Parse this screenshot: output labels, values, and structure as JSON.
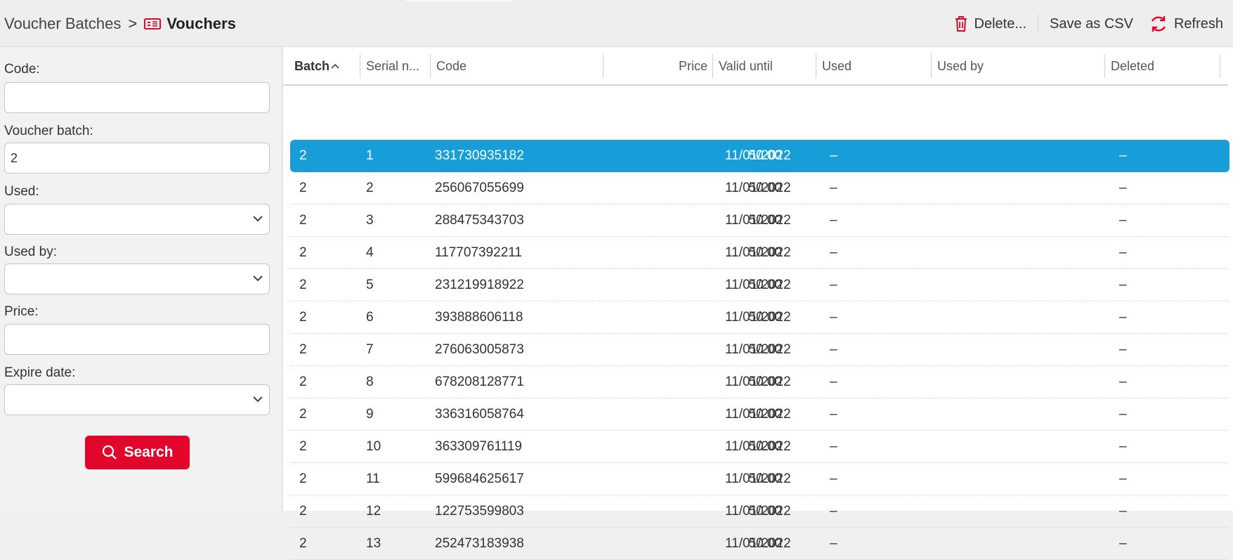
{
  "breadcrumb": {
    "parent": "Voucher Batches",
    "separator": ">",
    "current": "Vouchers",
    "current_icon": "voucher-icon"
  },
  "toolbar": {
    "delete_label": "Delete...",
    "delete_icon": "trash-icon",
    "csv_label": "Save as CSV",
    "refresh_label": "Refresh",
    "refresh_icon": "refresh-icon"
  },
  "filters": {
    "code": {
      "label": "Code:",
      "value": ""
    },
    "voucher_batch": {
      "label": "Voucher batch:",
      "value": "2"
    },
    "used": {
      "label": "Used:",
      "value": ""
    },
    "used_by": {
      "label": "Used by:",
      "value": ""
    },
    "price": {
      "label": "Price:",
      "value": ""
    },
    "expire_date": {
      "label": "Expire date:",
      "value": ""
    },
    "search_label": "Search"
  },
  "table": {
    "columns": [
      "Batch",
      "Serial n...",
      "Code",
      "Price",
      "Valid until",
      "Used",
      "Used by",
      "Deleted"
    ],
    "sorted_column": "Batch",
    "sort_direction": "ascending",
    "rows": [
      {
        "batch": "2",
        "serial": "1",
        "code": "331730935182",
        "price": "50.00",
        "valid": "11/01/2022",
        "used": "–",
        "used_by": "",
        "deleted": "–",
        "selected": true
      },
      {
        "batch": "2",
        "serial": "2",
        "code": "256067055699",
        "price": "50.00",
        "valid": "11/01/2022",
        "used": "–",
        "used_by": "",
        "deleted": "–"
      },
      {
        "batch": "2",
        "serial": "3",
        "code": "288475343703",
        "price": "50.00",
        "valid": "11/01/2022",
        "used": "–",
        "used_by": "",
        "deleted": "–"
      },
      {
        "batch": "2",
        "serial": "4",
        "code": "117707392211",
        "price": "50.00",
        "valid": "11/01/2022",
        "used": "–",
        "used_by": "",
        "deleted": "–"
      },
      {
        "batch": "2",
        "serial": "5",
        "code": "231219918922",
        "price": "50.00",
        "valid": "11/01/2022",
        "used": "–",
        "used_by": "",
        "deleted": "–"
      },
      {
        "batch": "2",
        "serial": "6",
        "code": "393888606118",
        "price": "50.00",
        "valid": "11/01/2022",
        "used": "–",
        "used_by": "",
        "deleted": "–"
      },
      {
        "batch": "2",
        "serial": "7",
        "code": "276063005873",
        "price": "50.00",
        "valid": "11/01/2022",
        "used": "–",
        "used_by": "",
        "deleted": "–"
      },
      {
        "batch": "2",
        "serial": "8",
        "code": "678208128771",
        "price": "50.00",
        "valid": "11/01/2022",
        "used": "–",
        "used_by": "",
        "deleted": "–"
      },
      {
        "batch": "2",
        "serial": "9",
        "code": "336316058764",
        "price": "50.00",
        "valid": "11/01/2022",
        "used": "–",
        "used_by": "",
        "deleted": "–"
      },
      {
        "batch": "2",
        "serial": "10",
        "code": "363309761119",
        "price": "50.00",
        "valid": "11/01/2022",
        "used": "–",
        "used_by": "",
        "deleted": "–"
      },
      {
        "batch": "2",
        "serial": "11",
        "code": "599684625617",
        "price": "50.00",
        "valid": "11/01/2022",
        "used": "–",
        "used_by": "",
        "deleted": "–"
      },
      {
        "batch": "2",
        "serial": "12",
        "code": "122753599803",
        "price": "50.00",
        "valid": "11/01/2022",
        "used": "–",
        "used_by": "",
        "deleted": "–"
      },
      {
        "batch": "2",
        "serial": "13",
        "code": "252473183938",
        "price": "50.00",
        "valid": "11/01/2022",
        "used": "–",
        "used_by": "",
        "deleted": "–"
      }
    ]
  },
  "colors": {
    "accent": "#e2062c",
    "selection": "#179ed8"
  }
}
